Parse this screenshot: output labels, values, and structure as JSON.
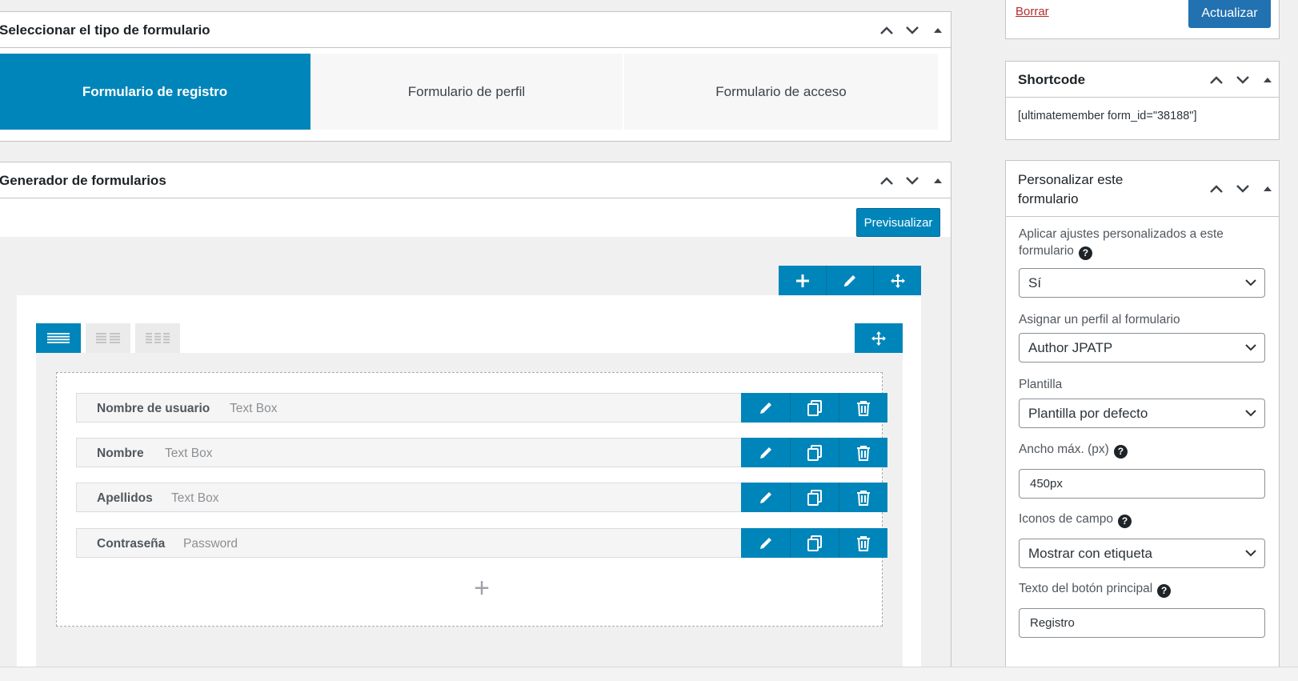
{
  "publish": {
    "delete_label": "Borrar",
    "update_label": "Actualizar"
  },
  "form_type": {
    "title": "Seleccionar el tipo de formulario",
    "tabs": [
      {
        "label": "Formulario de registro",
        "active": true
      },
      {
        "label": "Formulario de perfil",
        "active": false
      },
      {
        "label": "Formulario de acceso",
        "active": false
      }
    ]
  },
  "builder": {
    "title": "Generador de formularios",
    "preview_label": "Previsualizar",
    "fields": [
      {
        "name": "Nombre de usuario",
        "type": "Text Box"
      },
      {
        "name": "Nombre",
        "type": "Text Box"
      },
      {
        "name": "Apellidos",
        "type": "Text Box"
      },
      {
        "name": "Contraseña",
        "type": "Password"
      }
    ],
    "add_field_symbol": "+"
  },
  "shortcode": {
    "title": "Shortcode",
    "value": "[ultimatemember form_id=\"38188\"]"
  },
  "customize": {
    "title": "Personalizar este formulario",
    "title_line1": "Personalizar este",
    "title_line2": "formulario",
    "apply_label_line1": "Aplicar ajustes personalizados a este",
    "apply_label_line2": "formulario",
    "apply_value": "Sí",
    "role_label": "Asignar un perfil al formulario",
    "role_value": "Author JPATP",
    "template_label": "Plantilla",
    "template_value": "Plantilla por defecto",
    "max_width_label": "Ancho máx. (px)",
    "max_width_value": "450px",
    "icons_label": "Iconos de campo",
    "icons_value": "Mostrar con etiqueta",
    "button_label": "Texto del botón principal",
    "button_value": "Registro"
  },
  "colors": {
    "accent": "#0085ba",
    "link_delete": "#b32d2e",
    "publish_button": "#2271b1"
  },
  "icons": [
    "chevron-up-icon",
    "chevron-down-icon",
    "toggle-triangle-icon",
    "plus-icon",
    "pencil-icon",
    "move-icon",
    "duplicate-icon",
    "trash-icon",
    "help-icon",
    "select-chevron-icon",
    "one-column-icon",
    "two-column-icon",
    "three-column-icon"
  ]
}
